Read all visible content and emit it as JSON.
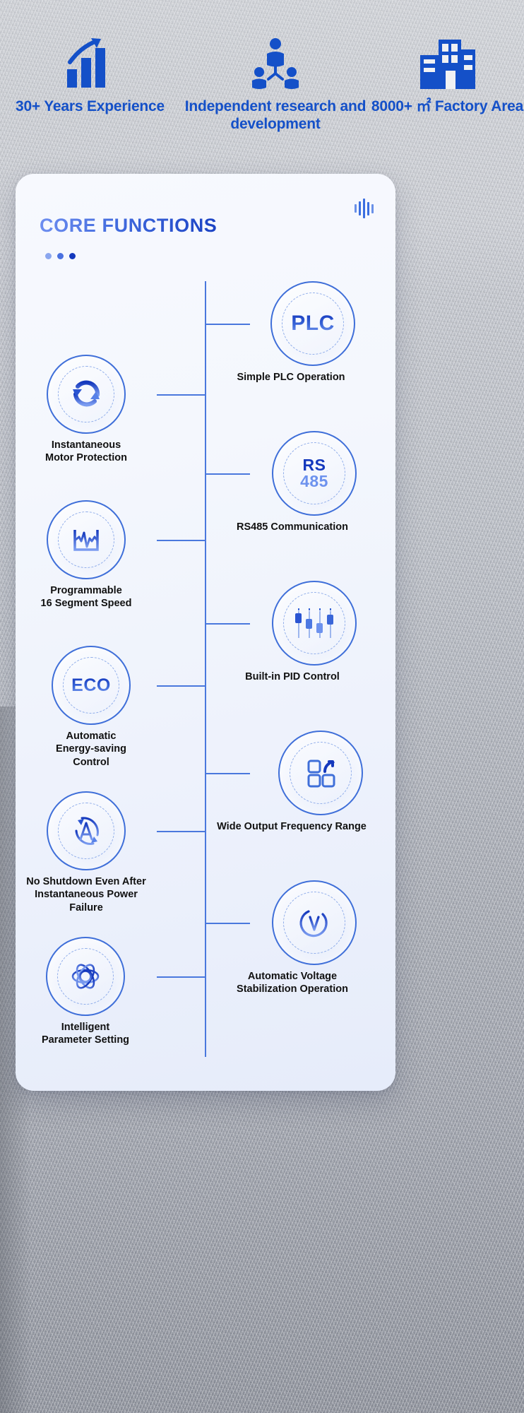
{
  "stats": [
    {
      "icon": "growth-bar-chart-icon",
      "label": "30+ Years\nExperience"
    },
    {
      "icon": "team-people-icon",
      "label": "Independent research\nand development"
    },
    {
      "icon": "factory-building-icon",
      "label": "8000+ ㎡\nFactory Area"
    }
  ],
  "card": {
    "title": "CORE FUNCTIONS",
    "corner_icon": "sound-wave-icon",
    "dots": [
      "dot-light",
      "dot-mid",
      "dot-dark"
    ]
  },
  "left_nodes": [
    {
      "icon": "refresh-cycle-icon",
      "glyph_text": "",
      "label": "Instantaneous\nMotor Protection"
    },
    {
      "icon": "signal-waveform-icon",
      "glyph_text": "",
      "label": "Programmable\n16 Segment Speed"
    },
    {
      "icon": "eco-text-icon",
      "glyph_text": "ECO",
      "label": "Automatic\nEnergy-saving Control"
    },
    {
      "icon": "auto-restart-a-icon",
      "glyph_text": "A",
      "label": "No Shutdown Even After\nInstantaneous Power Failure"
    },
    {
      "icon": "atom-orbit-icon",
      "glyph_text": "",
      "label": "Intelligent\nParameter Setting"
    }
  ],
  "right_nodes": [
    {
      "icon": "plc-text-icon",
      "glyph_text": "PLC",
      "label": "Simple PLC Operation"
    },
    {
      "icon": "rs485-text-icon",
      "glyph_top": "RS",
      "glyph_bottom": "485",
      "label": "RS485 Communication"
    },
    {
      "icon": "pid-sliders-icon",
      "glyph_text": "",
      "label": "Built-in PID Control"
    },
    {
      "icon": "frequency-blocks-icon",
      "glyph_text": "",
      "label": "Wide Output Frequency Range"
    },
    {
      "icon": "voltage-v-icon",
      "glyph_text": "V",
      "label": "Automatic Voltage\nStabilization Operation"
    }
  ],
  "colors": {
    "brand_blue": "#1450c8",
    "line_blue": "#4a78dd",
    "ring_blue": "#3f6fd9",
    "dashed_blue": "#91aeea",
    "card_bg": "#f5f8fd",
    "label_black": "#111111"
  }
}
